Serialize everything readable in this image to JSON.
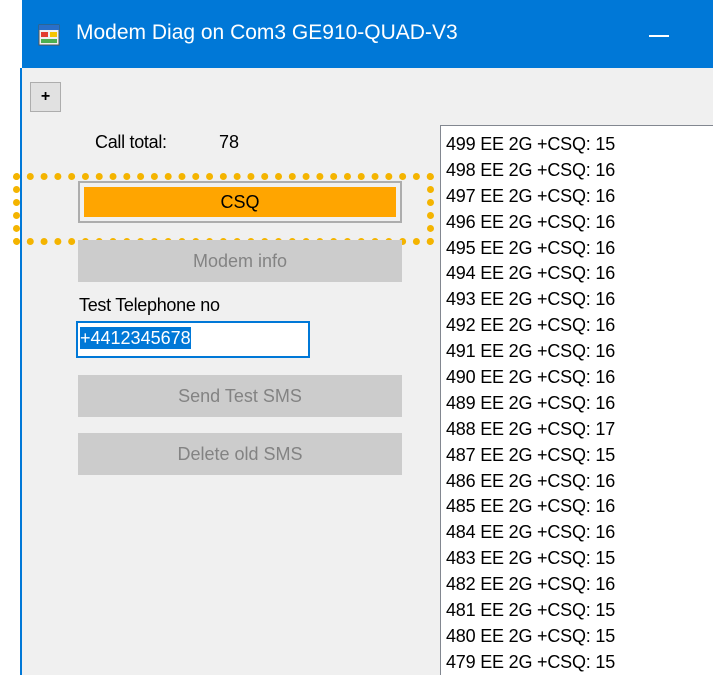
{
  "window": {
    "title": "Modem Diag on Com3 GE910-QUAD-V3"
  },
  "toolbar": {
    "plus_label": "+"
  },
  "stats": {
    "call_total_label": "Call total:",
    "call_total_value": "78"
  },
  "buttons": {
    "csq": "CSQ",
    "modem_info": "Modem info",
    "send_test_sms": "Send Test SMS",
    "delete_old_sms": "Delete old SMS"
  },
  "telephone": {
    "label": "Test Telephone no",
    "value": "+4412345678"
  },
  "log": [
    "499 EE 2G +CSQ: 15",
    "498 EE 2G +CSQ: 16",
    "497 EE 2G +CSQ: 16",
    "496 EE 2G +CSQ: 16",
    "495 EE 2G +CSQ: 16",
    "494 EE 2G +CSQ: 16",
    "493 EE 2G +CSQ: 16",
    "492 EE 2G +CSQ: 16",
    "491 EE 2G +CSQ: 16",
    "490 EE 2G +CSQ: 16",
    "489 EE 2G +CSQ: 16",
    "488 EE 2G +CSQ: 17",
    "487 EE 2G +CSQ: 15",
    "486 EE 2G +CSQ: 16",
    "485 EE 2G +CSQ: 16",
    "484 EE 2G +CSQ: 16",
    "483 EE 2G +CSQ: 15",
    "482 EE 2G +CSQ: 16",
    "481 EE 2G +CSQ: 15",
    "480 EE 2G +CSQ: 15",
    "479 EE 2G +CSQ: 15"
  ],
  "colors": {
    "titlebar": "#0078d7",
    "csq_button": "#ffa500",
    "highlight": "#f4b400"
  },
  "icons": {
    "app": "app-window-icon",
    "minimize": "minimize-icon"
  }
}
